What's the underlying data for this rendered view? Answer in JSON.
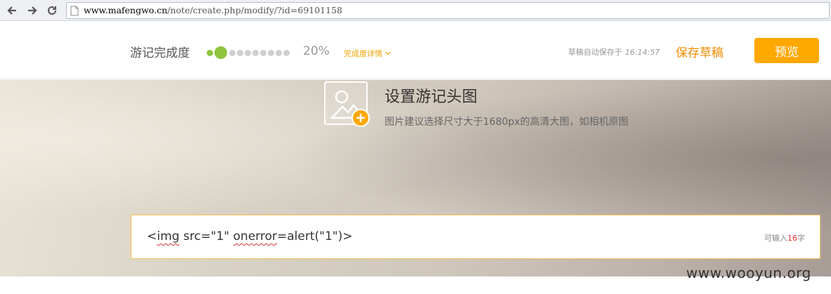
{
  "browser": {
    "url_host": "www.mafengwo.cn",
    "url_path": "/note/create.php/modify/?id=69101158"
  },
  "header": {
    "progress_label": "游记完成度",
    "progress_percent": 20,
    "progress_text": "20%",
    "detail_link": "完成度详情",
    "autosave_text": "草稿自动保存于",
    "autosave_time": "16:14:57",
    "save_draft": "保存草稿",
    "preview": "预览",
    "accent_color": "#ffa800"
  },
  "cover": {
    "title": "设置游记头图",
    "hint": "图片建议选择尺寸大于1680px的高清大图，如相机原图",
    "icon": "image-placeholder-icon"
  },
  "title_field": {
    "value_parts": [
      "<",
      "img",
      " src=\"1\" ",
      "onerror",
      "=alert(\"1\")>"
    ],
    "counter_prefix": "可输入",
    "counter_num": "16",
    "counter_suffix": "字"
  },
  "watermark": "www.wooyun.org"
}
